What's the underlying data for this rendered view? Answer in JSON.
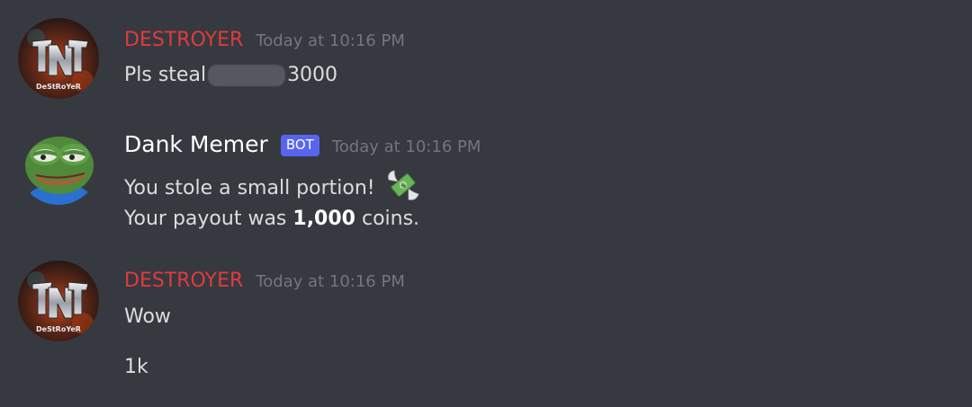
{
  "messages": [
    {
      "author": "DESTROYER",
      "timestamp": "Today at 10:16 PM",
      "avatar_icon": "destroyer-tnt-avatar",
      "avatar_text": "DeStRoYeR",
      "name_color": "#e03b3e",
      "lines": [
        {
          "prefix": "Pls steal",
          "suffix": "3000"
        }
      ]
    },
    {
      "author": "Dank Memer",
      "badge": "BOT",
      "timestamp": "Today at 10:16 PM",
      "avatar_icon": "pepe-frog-avatar",
      "lines": [
        {
          "text": "You stole a small portion!",
          "emoji": "money-with-wings-icon"
        },
        {
          "prefix": "Your payout was",
          "bold": "1,000",
          "suffix": "coins."
        }
      ]
    },
    {
      "author": "DESTROYER",
      "timestamp": "Today at 10:16 PM",
      "avatar_icon": "destroyer-tnt-avatar",
      "avatar_text": "DeStRoYeR",
      "name_color": "#e03b3e",
      "lines": [
        {
          "text": "Wow"
        },
        {
          "text": "1k"
        }
      ]
    }
  ],
  "colors": {
    "background": "#36393f",
    "text": "#dcddde",
    "timestamp": "#72767d",
    "bot_badge": "#5865f2"
  }
}
